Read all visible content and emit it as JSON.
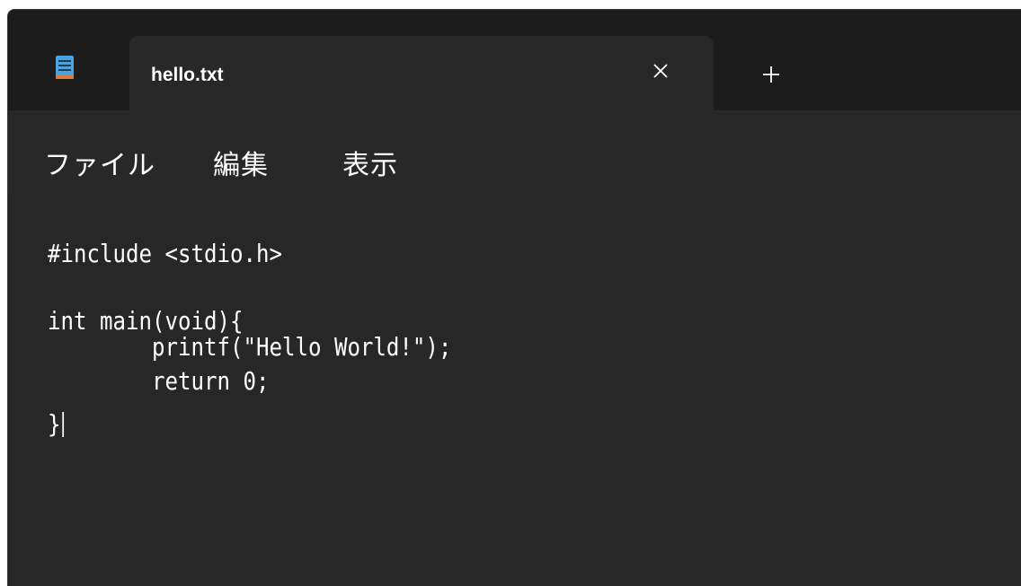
{
  "app": {
    "icon": "notepad-icon"
  },
  "tabs": [
    {
      "label": "hello.txt",
      "active": true
    }
  ],
  "tab_controls": {
    "close_icon": "close-icon",
    "new_tab_icon": "plus-icon"
  },
  "menu": {
    "items": [
      "ファイル",
      "編集",
      "表示"
    ]
  },
  "editor": {
    "lines": [
      "#include <stdio.h>",
      "int main(void){",
      "        printf(\"Hello World!\");",
      "        return 0;",
      "}"
    ]
  },
  "colors": {
    "background": "#1c1c1c",
    "tab_background": "#282828",
    "editor_background": "#272727",
    "text": "#ffffff",
    "icon_blue": "#4aa3df",
    "icon_orange": "#e07b39"
  }
}
